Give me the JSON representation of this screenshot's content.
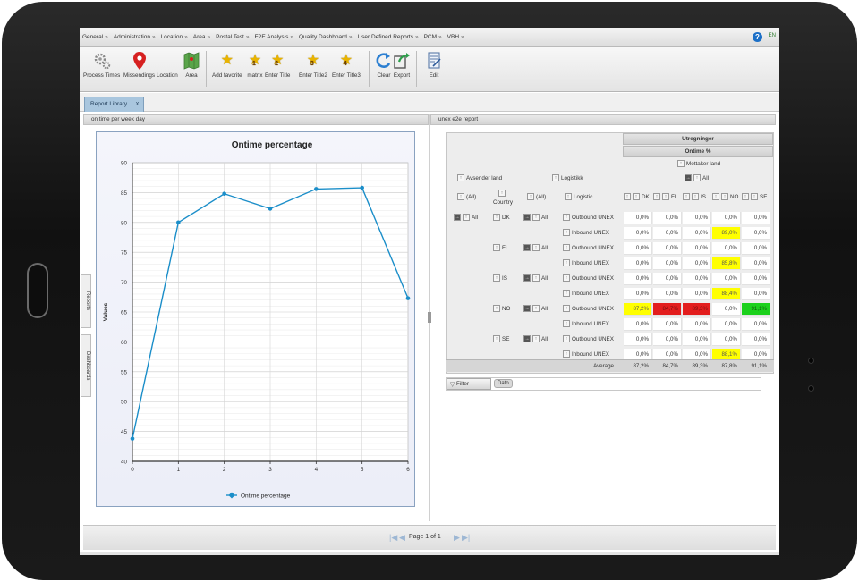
{
  "menu": [
    "General",
    "Administration",
    "Location",
    "Area",
    "Postal Test",
    "E2E Analysis",
    "Quality Dashboard",
    "User Defined Reports",
    "PCM",
    "VBH"
  ],
  "menu_caret": "»",
  "help": "?",
  "lang": "EN",
  "toolbar": {
    "process_times": "Process Times",
    "missendings": "Missendings",
    "location": "Location",
    "area": "Area",
    "add_favorite": "Add favorite",
    "matrix": "matrix",
    "enter_title": "Enter Title",
    "enter_title2": "Enter Title2",
    "enter_title3": "Enter Title3",
    "clear": "Clear",
    "export": "Export",
    "edit": "Edit",
    "star_nums": [
      "1",
      "2",
      "3",
      "4"
    ]
  },
  "tab": {
    "label": "Report Library",
    "close": "x"
  },
  "left_panel": {
    "title": "on time per week day"
  },
  "right_panel": {
    "title": "unex e2e report"
  },
  "side_tabs": {
    "reports": "Reports",
    "dashboards": "Dashboards"
  },
  "chart_data": {
    "type": "line",
    "title": "Ontime percentage",
    "ylabel": "Values",
    "xlabel": "",
    "x": [
      0,
      1,
      2,
      3,
      4,
      5,
      6
    ],
    "series": [
      {
        "name": "Ontime percentage",
        "values": [
          43.8,
          80.0,
          84.8,
          82.3,
          85.6,
          85.8,
          67.3
        ],
        "color": "#1b8ec9"
      }
    ],
    "ylim": [
      40,
      90
    ],
    "yticks": [
      40,
      45,
      50,
      55,
      60,
      65,
      70,
      75,
      80,
      85,
      90
    ],
    "grid": true,
    "legend": "bottom"
  },
  "report": {
    "col_header1": "Utregninger",
    "col_header2": "Ontime %",
    "col_header3": "Mottaker land",
    "row_fields": {
      "sender": "Avsender land",
      "logistics": "Logistikk",
      "all": "All"
    },
    "row_headers": {
      "all1": "(All)",
      "country": "Country",
      "all2": "(All)",
      "logistic": "Logistic"
    },
    "col_countries": [
      "DK",
      "FI",
      "IS",
      "NO",
      "SE"
    ],
    "top_all": "All",
    "rows": [
      {
        "country": "DK",
        "group": "All",
        "logistic": "Outbound UNEX",
        "values": [
          "0,0%",
          "0,0%",
          "0,0%",
          "0,0%",
          "0,0%"
        ]
      },
      {
        "country": "",
        "group": "",
        "logistic": "Inbound UNEX",
        "values": [
          "0,0%",
          "0,0%",
          "0,0%",
          "89,0%",
          "0,0%"
        ]
      },
      {
        "country": "FI",
        "group": "All",
        "logistic": "Outbound UNEX",
        "values": [
          "0,0%",
          "0,0%",
          "0,0%",
          "0,0%",
          "0,0%"
        ]
      },
      {
        "country": "",
        "group": "",
        "logistic": "Inbound UNEX",
        "values": [
          "0,0%",
          "0,0%",
          "0,0%",
          "85,8%",
          "0,0%"
        ]
      },
      {
        "country": "IS",
        "group": "All",
        "logistic": "Outbound UNEX",
        "values": [
          "0,0%",
          "0,0%",
          "0,0%",
          "0,0%",
          "0,0%"
        ]
      },
      {
        "country": "",
        "group": "",
        "logistic": "Inbound UNEX",
        "values": [
          "0,0%",
          "0,0%",
          "0,0%",
          "88,4%",
          "0,0%"
        ]
      },
      {
        "country": "NO",
        "group": "All",
        "logistic": "Outbound UNEX",
        "values": [
          "87,2%",
          "84,7%",
          "89,3%",
          "0,0%",
          "91,1%"
        ]
      },
      {
        "country": "",
        "group": "",
        "logistic": "Inbound UNEX",
        "values": [
          "0,0%",
          "0,0%",
          "0,0%",
          "0,0%",
          "0,0%"
        ]
      },
      {
        "country": "SE",
        "group": "All",
        "logistic": "Outbound UNEX",
        "values": [
          "0,0%",
          "0,0%",
          "0,0%",
          "0,0%",
          "0,0%"
        ]
      },
      {
        "country": "",
        "group": "",
        "logistic": "Inbound UNEX",
        "values": [
          "0,0%",
          "0,0%",
          "0,0%",
          "88,1%",
          "0,0%"
        ]
      }
    ],
    "highlight": {
      "1-3": "yellow",
      "3-3": "yellow",
      "5-3": "yellow",
      "9-3": "yellow",
      "6-0": "yellow",
      "6-1": "red",
      "6-2": "red",
      "6-4": "green"
    },
    "average_label": "Average",
    "averages": [
      "87,2%",
      "84,7%",
      "89,3%",
      "87,8%",
      "91,1%"
    ]
  },
  "filter": {
    "label": "Filter",
    "date_chip": "Dato"
  },
  "pager": {
    "text": "Page 1 of 1"
  },
  "colors": {
    "accent": "#1b8ec9",
    "tab": "#a9c6de",
    "yellow": "#ffff00",
    "red": "#e31e1e",
    "green": "#1cd11c"
  }
}
